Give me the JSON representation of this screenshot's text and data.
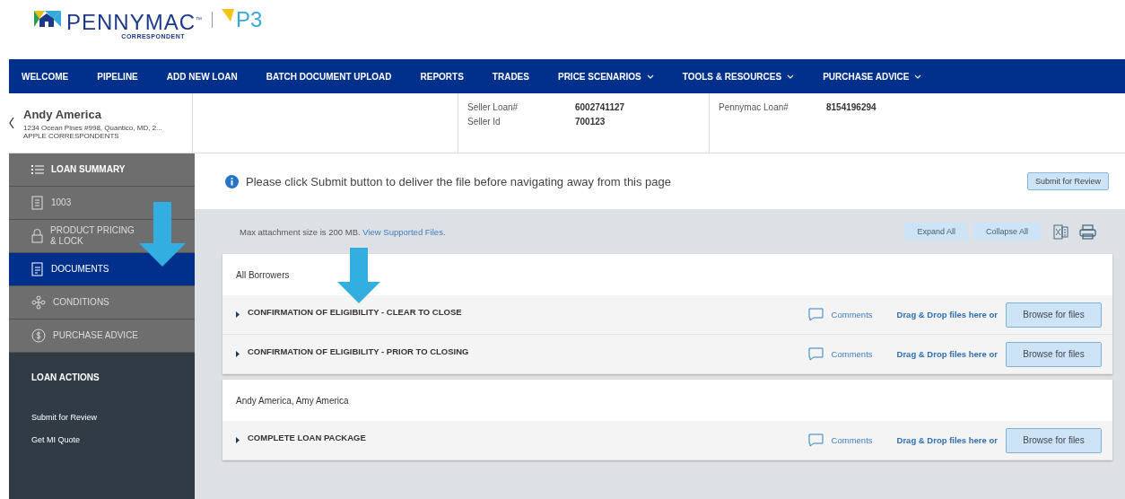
{
  "logo": {
    "brand": "PENNYMAC$^{™}$",
    "subtitle": "CORRESPONDENT",
    "product": "P3"
  },
  "nav": [
    {
      "label": "WELCOME",
      "dropdown": false
    },
    {
      "label": "PIPELINE",
      "dropdown": false
    },
    {
      "label": "ADD NEW LOAN",
      "dropdown": false
    },
    {
      "label": "BATCH DOCUMENT UPLOAD",
      "dropdown": false
    },
    {
      "label": "REPORTS",
      "dropdown": false
    },
    {
      "label": "TRADES",
      "dropdown": false
    },
    {
      "label": "PRICE SCENARIOS",
      "dropdown": true
    },
    {
      "label": "TOOLS & RESOURCES",
      "dropdown": true
    },
    {
      "label": "PURCHASE ADVICE",
      "dropdown": true
    }
  ],
  "borrower": {
    "name": "Andy America",
    "address": "1234 Ocean Pines #998, Quantico, MD, 2...",
    "company": "APPLE CORRESPONDENTS"
  },
  "loan_info": [
    {
      "label": "Seller Loan#",
      "value": "6002741127"
    },
    {
      "label": "Seller Id",
      "value": "700123"
    }
  ],
  "pennymac_loan": {
    "label": "Pennymac Loan#",
    "value": "8154196294"
  },
  "sidebar": {
    "items": [
      {
        "label": "LOAN SUMMARY",
        "selected": false
      },
      {
        "label": "1003",
        "selected": false
      },
      {
        "label": "PRODUCT PRICING & LOCK",
        "selected": false
      },
      {
        "label": "DOCUMENTS",
        "selected": true
      },
      {
        "label": "CONDITIONS",
        "selected": false
      },
      {
        "label": "PURCHASE ADVICE",
        "selected": false
      }
    ],
    "actions_title": "LOAN ACTIONS",
    "actions": [
      "Submit for Review",
      "Get MI Quote"
    ]
  },
  "notice": "Please click Submit button to deliver the file before navigating away from this page",
  "submit_button": "Submit for Review",
  "attachment_note": "Max attachment size is 200 MB.",
  "supported_link": "View Supported Files.",
  "expand_all": "Expand All",
  "collapse_all": "Collapse All",
  "sections": [
    {
      "title": "All Borrowers",
      "documents": [
        {
          "name": "CONFIRMATION OF ELIGIBILITY - CLEAR TO CLOSE",
          "comments": "Comments",
          "drop_text": "Drag & Drop files here or",
          "browse": "Browse for files"
        },
        {
          "name": "CONFIRMATION OF ELIGIBILITY - PRIOR TO CLOSING",
          "comments": "Comments",
          "drop_text": "Drag & Drop files here or",
          "browse": "Browse for files"
        }
      ]
    },
    {
      "title": "Andy America, Amy America",
      "documents": [
        {
          "name": "COMPLETE LOAN PACKAGE",
          "comments": "Comments",
          "drop_text": "Drag & Drop files here or",
          "browse": "Browse for files"
        }
      ]
    }
  ]
}
